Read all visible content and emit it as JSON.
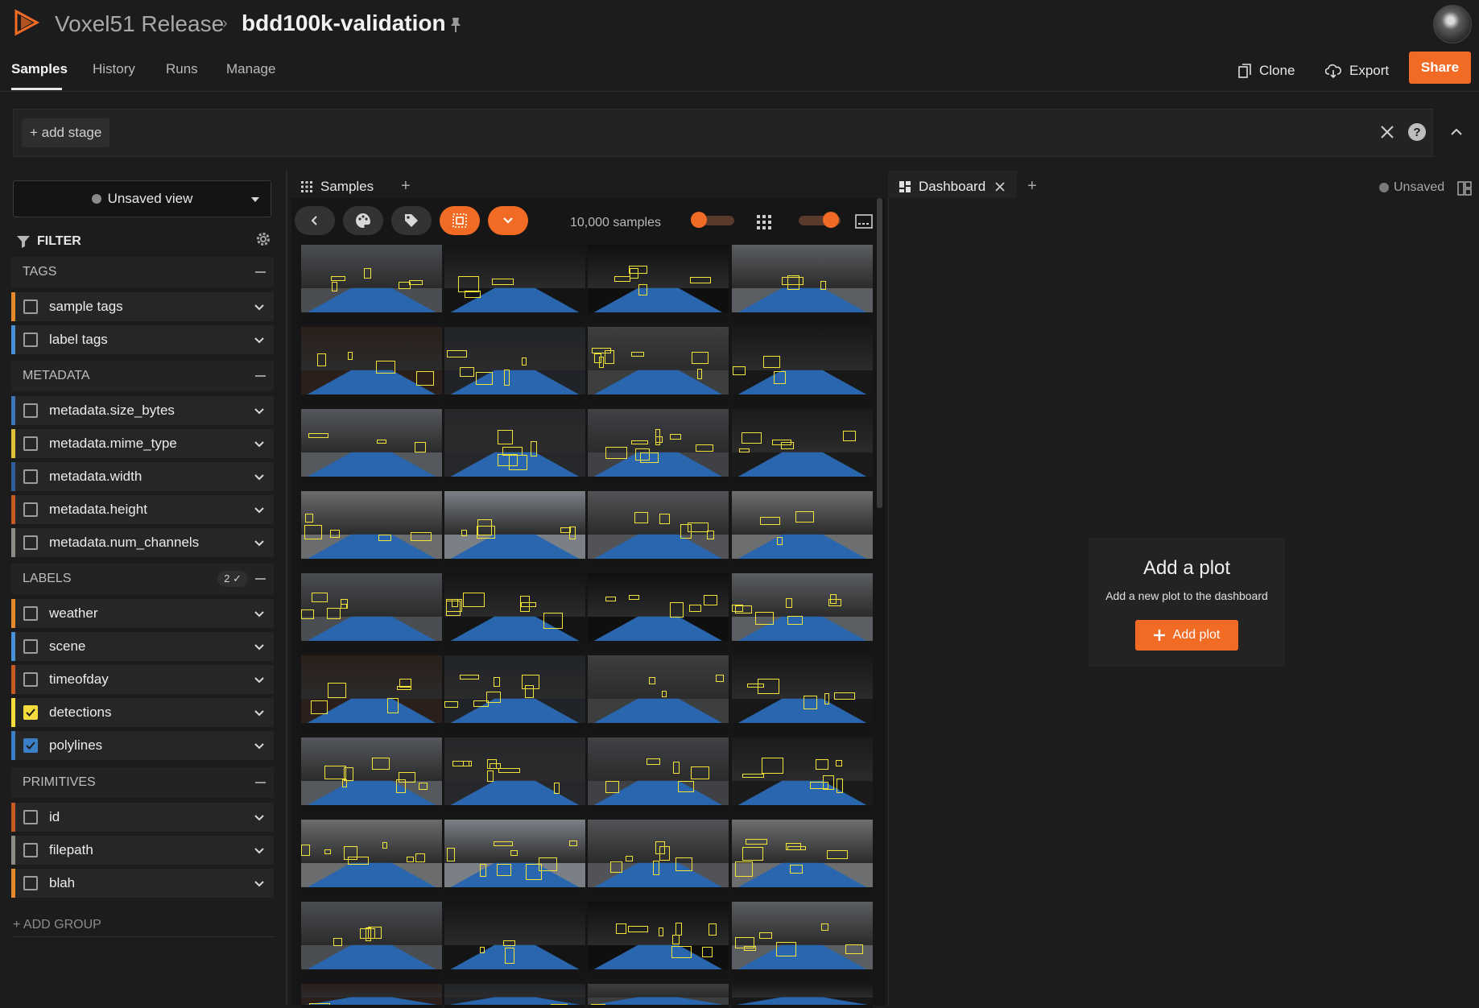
{
  "header": {
    "brand": "Voxel51 Release",
    "separator": "›",
    "dataset": "bdd100k-validation"
  },
  "nav": {
    "tabs": [
      "Samples",
      "History",
      "Runs",
      "Manage"
    ],
    "clone_label": "Clone",
    "export_label": "Export",
    "share_label": "Share"
  },
  "viewbar": {
    "add_stage": "+ add stage",
    "help": "?"
  },
  "sidebar": {
    "view_label": "Unsaved view",
    "filter_label": "FILTER",
    "groups": {
      "tags": "TAGS",
      "metadata": "METADATA",
      "labels": "LABELS",
      "labels_badge": "2 ✓",
      "primitives": "PRIMITIVES"
    },
    "fields": {
      "sample_tags": "sample tags",
      "label_tags": "label tags",
      "size_bytes": "metadata.size_bytes",
      "mime_type": "metadata.mime_type",
      "width": "metadata.width",
      "height": "metadata.height",
      "num_channels": "metadata.num_channels",
      "weather": "weather",
      "scene": "scene",
      "timeofday": "timeofday",
      "detections": "detections",
      "polylines": "polylines",
      "id": "id",
      "filepath": "filepath",
      "blah": "blah"
    },
    "add_group": "+ ADD GROUP"
  },
  "grid": {
    "tab_label": "Samples",
    "tab_add": "+",
    "sample_count": "10,000 samples"
  },
  "dashboard": {
    "tab_label": "Dashboard",
    "tab_add": "+",
    "status": "Unsaved",
    "plot_title": "Add a plot",
    "plot_subtitle": "Add a new plot to the dashboard",
    "add_plot_label": "Add plot"
  },
  "colors": {
    "accent": "#f26b24",
    "polyline_blue": "#2a66ad",
    "detection_yellow": "#f2e43a"
  }
}
